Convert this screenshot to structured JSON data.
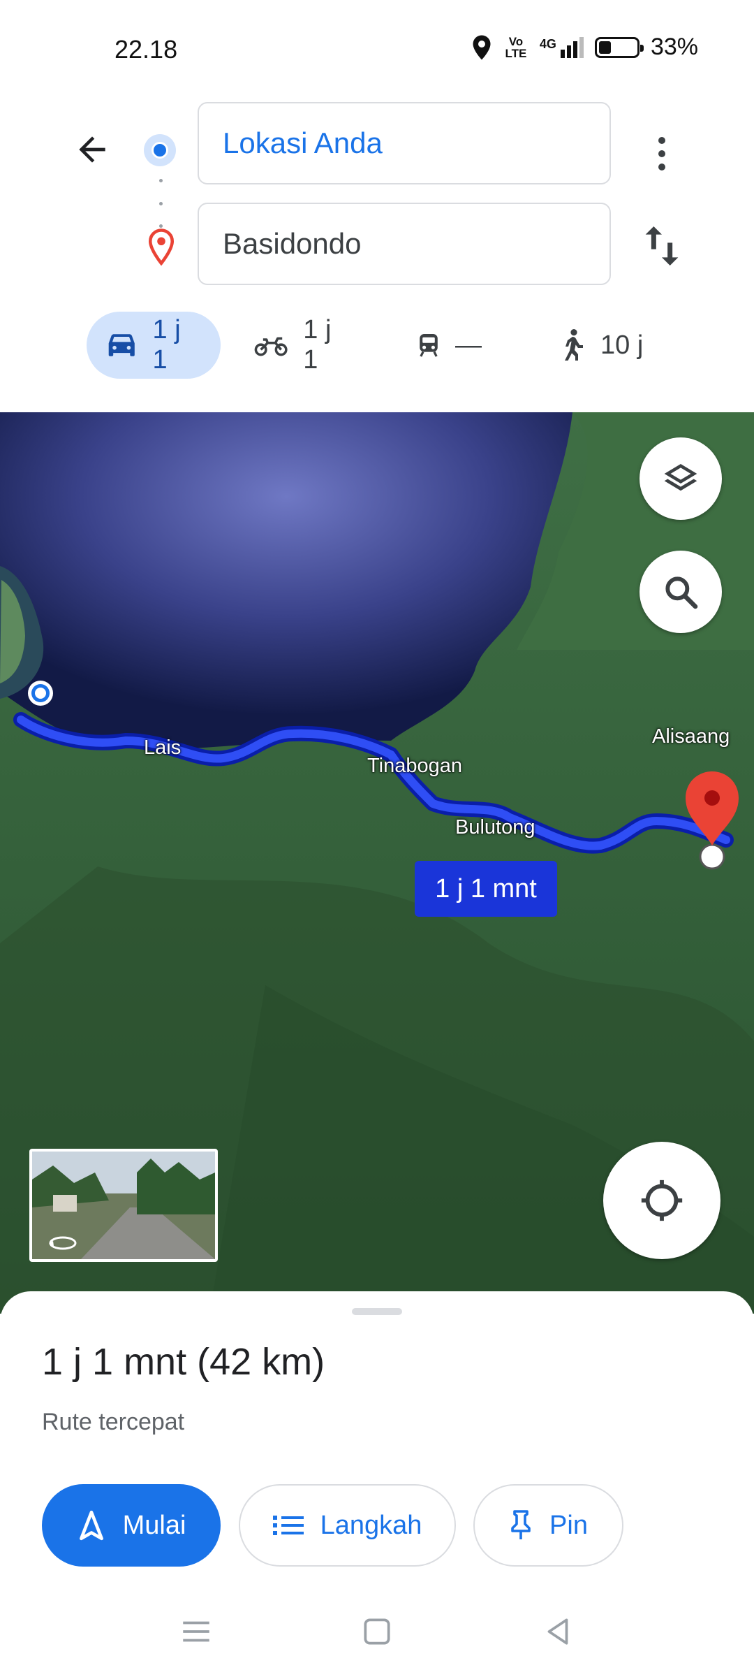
{
  "status": {
    "time": "22.18",
    "volte": "Vo LTE",
    "network": "4G",
    "battery_percent": "33%",
    "battery_level": 0.33
  },
  "header": {
    "origin": "Lokasi Anda",
    "destination": "Basidondo"
  },
  "modes": [
    {
      "icon": "car-icon",
      "label": "1 j 1",
      "active": true
    },
    {
      "icon": "motorcycle-icon",
      "label": "1 j 1",
      "active": false
    },
    {
      "icon": "train-icon",
      "label": "—",
      "active": false
    },
    {
      "icon": "walk-icon",
      "label": "10 j",
      "active": false
    }
  ],
  "map": {
    "labels": [
      "Lais",
      "Tinabogan",
      "Bulutong",
      "Alisaang"
    ],
    "eta_chip": "1 j 1 mnt",
    "route_color": "#1a35d9"
  },
  "sheet": {
    "summary": "1 j 1 mnt (42 km)",
    "subtitle": "Rute tercepat",
    "buttons": {
      "start": "Mulai",
      "steps": "Langkah",
      "pin": "Pin"
    }
  },
  "colors": {
    "accent": "#1a73e8",
    "pin_red": "#ea4335"
  }
}
